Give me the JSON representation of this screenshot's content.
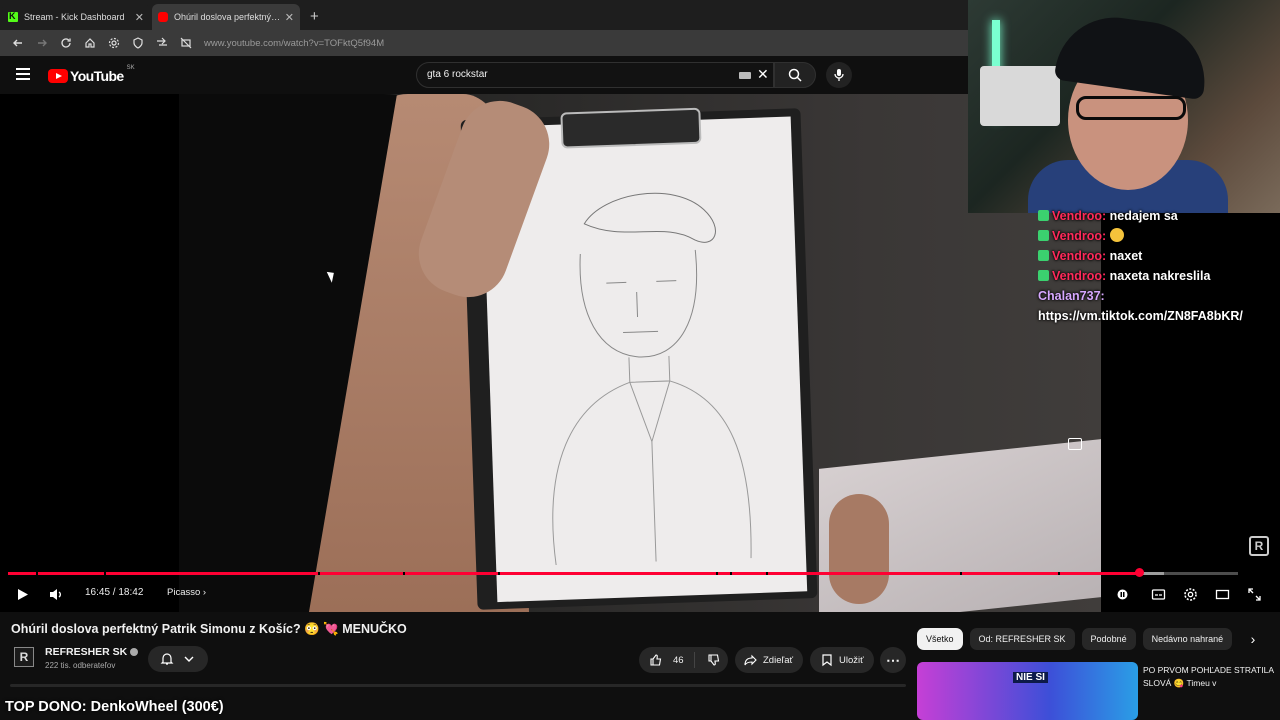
{
  "browser": {
    "tabs": [
      {
        "label": "Stream - Kick Dashboard",
        "active": false
      },
      {
        "label": "Ohúril doslova perfektný Patrik",
        "active": true
      }
    ],
    "url": "www.youtube.com/watch?v=TOFktQ5f94M"
  },
  "youtube": {
    "logo_text": "YouTube",
    "country_code": "SK",
    "search_value": "gta 6 rockstar"
  },
  "player": {
    "time_current": "16:45",
    "time_total": "18:42",
    "progress_fraction": 0.9195,
    "buffered_fraction": 0.94,
    "chapter_label": "Picasso"
  },
  "video": {
    "title": "Ohúril doslova perfektný Patrik Simonu z Košíc? 😳 💘 MENUČKO",
    "channel": "REFRESHER SK",
    "subscribers": "222 tis. odberateľov",
    "likes": "46",
    "share_label": "Zdieľať",
    "save_label": "Uložiť"
  },
  "recommendations": {
    "chips": [
      "Všetko",
      "Od: REFRESHER SK",
      "Podobné",
      "Nedávno nahrané"
    ],
    "active_chip": 0,
    "first": {
      "thumb_text": "NIE SI",
      "title": "PO PRVOM POHĽADE STRATILA SLOVÁ 😋 Timeu v"
    }
  },
  "overlay": {
    "chat": [
      {
        "user": "Vendroo:",
        "message": "nedajem sa",
        "color": "red",
        "badge": true,
        "emoji": false
      },
      {
        "user": "Vendroo:",
        "message": "",
        "color": "red",
        "badge": true,
        "emoji": true
      },
      {
        "user": "Vendroo:",
        "message": "naxet",
        "color": "red",
        "badge": true,
        "emoji": false
      },
      {
        "user": "Vendroo:",
        "message": "naxeta nakreslila",
        "color": "red",
        "badge": true,
        "emoji": false
      }
    ],
    "chalan_user": "Chalan737:",
    "chalan_message": "https://vm.tiktok.com/ZN8FA8bKR/",
    "top_dono": "TOP DONO: DenkoWheel (300€)"
  },
  "colors": {
    "accent": "#ff0033",
    "background": "#0f0f0f",
    "chat_user_red": "#ff2a5b",
    "chat_user_purple": "#d7a8ff"
  }
}
